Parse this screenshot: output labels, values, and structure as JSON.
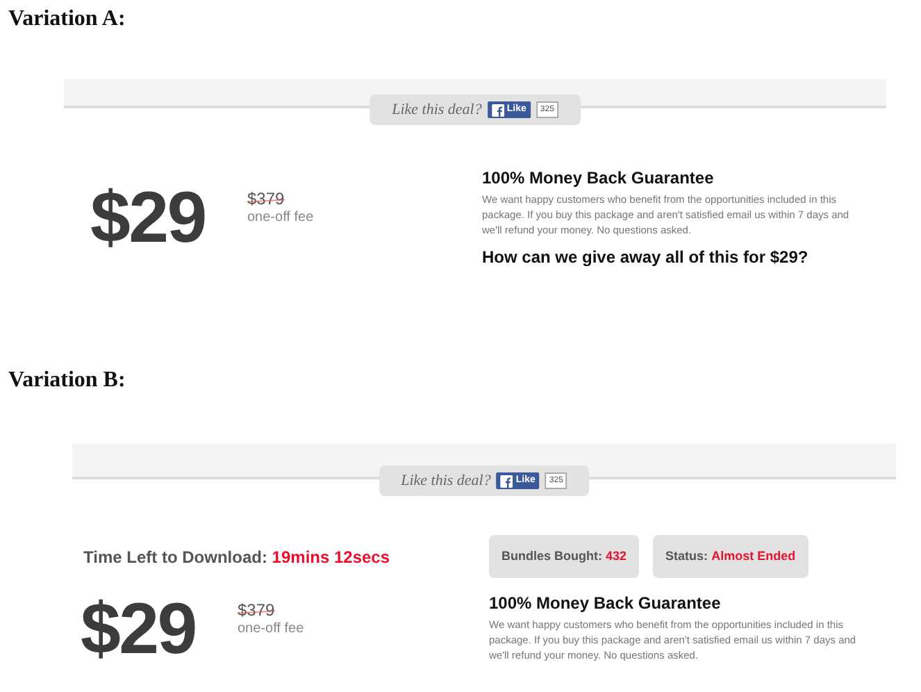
{
  "variations": [
    {
      "heading": "Variation A:",
      "like_bar": {
        "prompt": "Like this deal?",
        "like_button": "Like",
        "count": "325"
      },
      "price": {
        "amount": "$29",
        "old_price": "$379",
        "note": "one-off fee"
      },
      "guarantee": {
        "title": "100% Money Back Guarantee",
        "text": "We want happy customers who benefit from the opportunities included in this package. If you buy this package and aren't satisfied email us within 7 days and we'll refund your money. No questions asked.",
        "question": "How can we give away all of this for $29?"
      }
    },
    {
      "heading": "Variation B:",
      "like_bar": {
        "prompt": "Like this deal?",
        "like_button": "Like",
        "count": "325"
      },
      "countdown": {
        "label": "Time Left to Download:",
        "value": "19mins 12secs"
      },
      "stats": [
        {
          "label": "Bundles Bought:",
          "value": "432"
        },
        {
          "label": "Status:",
          "value": "Almost Ended"
        }
      ],
      "price": {
        "amount": "$29",
        "old_price": "$379",
        "note": "one-off fee"
      },
      "guarantee": {
        "title": "100% Money Back Guarantee",
        "text": "We want happy customers who benefit from the opportunities included in this package. If you buy this package and aren't satisfied email us within 7 days and we'll refund your money. No questions asked."
      }
    }
  ]
}
